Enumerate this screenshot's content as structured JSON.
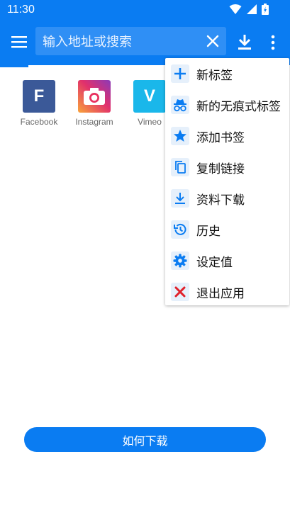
{
  "status_bar": {
    "time": "11:30"
  },
  "toolbar": {
    "address_placeholder": "输入地址或搜索",
    "accent_color": "#0a7cf2"
  },
  "shortcuts": [
    {
      "label": "Facebook",
      "letter": "F",
      "color": "#3b5998"
    },
    {
      "label": "Instagram",
      "icon": "camera-icon",
      "color": "#e1306c"
    },
    {
      "label": "Vimeo",
      "letter": "V",
      "color": "#1ab7ea"
    }
  ],
  "menu": {
    "items": [
      {
        "label": "新标签",
        "icon": "plus-icon"
      },
      {
        "label": "新的无痕式标签",
        "icon": "incognito-icon"
      },
      {
        "label": "添加书签",
        "icon": "star-icon"
      },
      {
        "label": "复制链接",
        "icon": "copy-icon"
      },
      {
        "label": "资料下载",
        "icon": "download-icon"
      },
      {
        "label": "历史",
        "icon": "history-icon"
      },
      {
        "label": "设定值",
        "icon": "gear-icon"
      },
      {
        "label": "退出应用",
        "icon": "close-icon"
      }
    ]
  },
  "footer": {
    "how_to_download": "如何下载"
  }
}
